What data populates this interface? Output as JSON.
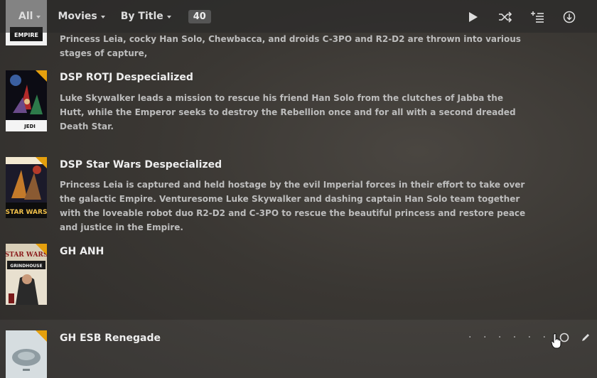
{
  "toolbar": {
    "filter_all": "All",
    "filter_type": "Movies",
    "sort": "By Title",
    "count": "40",
    "icons": [
      "play-icon",
      "shuffle-icon",
      "add-to-queue-icon",
      "download-icon"
    ]
  },
  "items": [
    {
      "title": "",
      "summary": "Princess Leia, cocky Han Solo, Chewbacca, and droids C-3PO and R2-D2 are thrown into various stages of capture,",
      "poster_text": "EMPIRE"
    },
    {
      "title": "DSP ROTJ Despecialized",
      "summary": "Luke Skywalker leads a mission to rescue his friend Han Solo from the clutches of Jabba the Hutt, while the Emperor seeks to destroy the Rebellion once and for all with a second dreaded Death Star.",
      "poster_text": "RETURN OF THE JEDI"
    },
    {
      "title": "DSP Star Wars Despecialized",
      "summary": "Princess Leia is captured and held hostage by the evil Imperial forces in their effort to take over the galactic Empire. Venturesome Luke Skywalker and dashing captain Han Solo team together with the loveable robot duo R2-D2 and C-3PO to rescue the beautiful princess and restore peace and justice in the Empire.",
      "poster_text": "STAR WARS"
    },
    {
      "title": "GH ANH",
      "summary": "",
      "poster_text": "STAR WARS GRINDHOUSE"
    },
    {
      "title": "GH ESB Renegade",
      "summary": "",
      "poster_text": ""
    }
  ],
  "row_actions": {
    "dots": "· · · · · ·"
  }
}
